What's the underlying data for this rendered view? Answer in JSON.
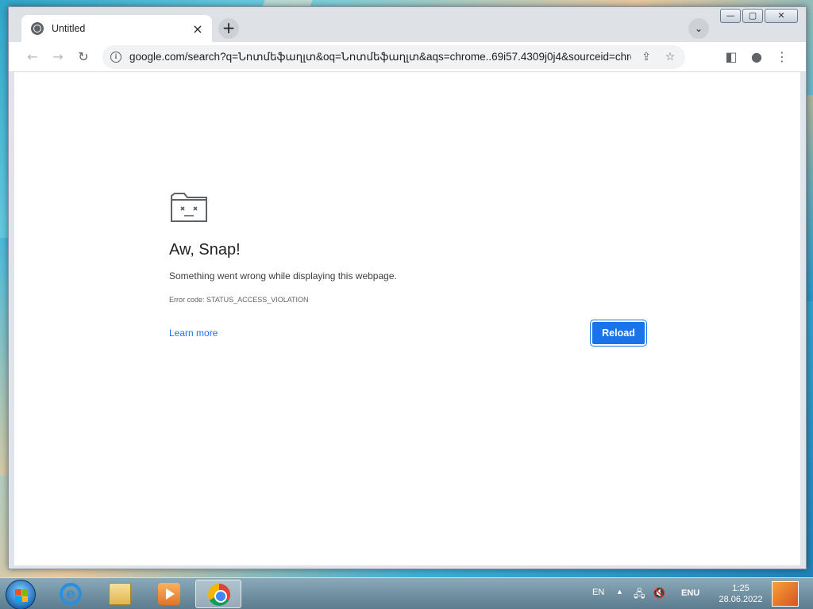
{
  "browser": {
    "tab_title": "Untitled",
    "tab_close": "×",
    "new_tab": "+",
    "tab_search": "⌄",
    "url": "google.com/search?q=Նոտմեֆաղլտ&oq=Նոտմեֆաղլտ&aqs=chrome..69i57.4309j0j4&sourceid=chrom...",
    "window_controls": {
      "minimize": "—",
      "maximize": "▢",
      "close": "✕"
    },
    "nav": {
      "back": "←",
      "forward": "→",
      "reload": "↻"
    },
    "omnibox_icons": {
      "info": "i",
      "share": "⇪",
      "bookmark": "☆",
      "side_panel": "◧",
      "profile": "●",
      "menu": "⋮"
    }
  },
  "error_page": {
    "title": "Aw, Snap!",
    "message": "Something went wrong while displaying this webpage.",
    "error_code": "Error code: STATUS_ACCESS_VIOLATION",
    "learn_more": "Learn more",
    "reload_button": "Reload"
  },
  "taskbar": {
    "apps": [
      "internet-explorer-icon",
      "file-explorer-icon",
      "media-player-icon",
      "chrome-icon"
    ],
    "lang_indicator": "EN",
    "tray_arrow": "▲",
    "input_lang": "ENU",
    "time": "1:25",
    "date": "28.06.2022"
  },
  "colors": {
    "accent": "#1a73e8",
    "tab_strip": "#dee1e6",
    "taskbar": "#5c7c8f"
  }
}
